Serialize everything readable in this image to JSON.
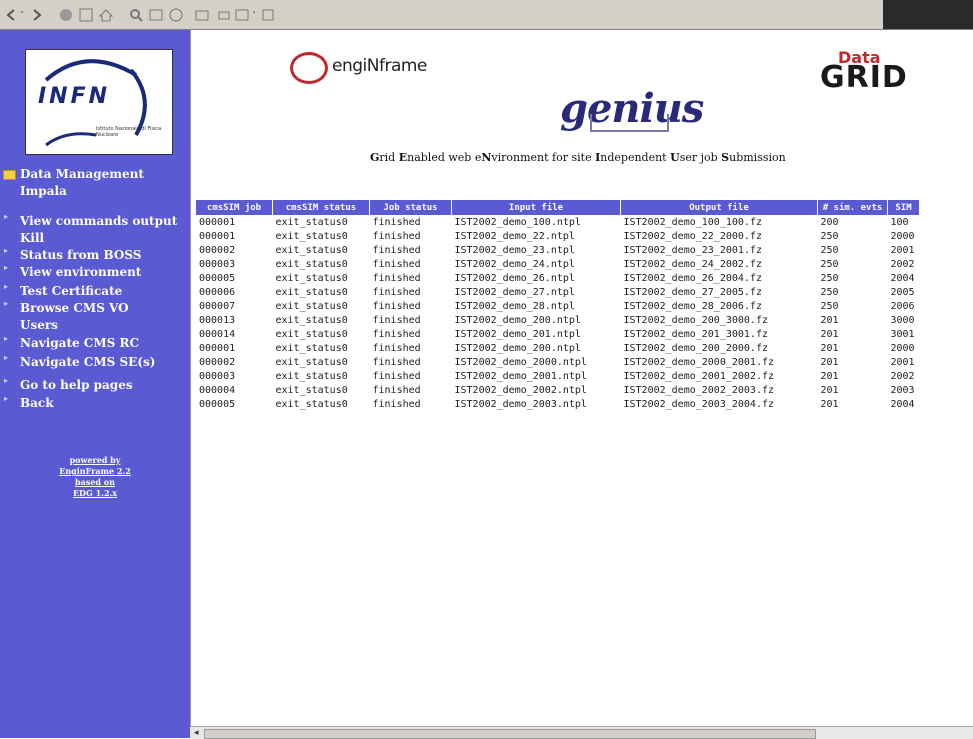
{
  "sidebar": {
    "logo": {
      "title": "INFN",
      "subtitle": "Istituto Nazionale di Fisica Nucleare"
    },
    "section": "Data Management",
    "items": [
      {
        "label": "Impala"
      },
      {
        "label": "View commands output"
      },
      {
        "label": "Kill"
      },
      {
        "label": "Status from BOSS"
      },
      {
        "label": "View environment"
      },
      {
        "label": "Test Certificate"
      },
      {
        "label": "Browse CMS VO"
      },
      {
        "label": "Users"
      },
      {
        "label": "Navigate CMS RC"
      },
      {
        "label": "Navigate CMS SE(s)"
      },
      {
        "label": "Go to help pages"
      },
      {
        "label": "Back"
      }
    ],
    "powered_by": [
      "powered by",
      "EnginFrame 2.2",
      "based on",
      "EDG 1.2.x"
    ]
  },
  "header": {
    "enginframe": "engiNframe",
    "genius": "genius",
    "datagrid_top": "Data",
    "datagrid_bottom": "GRID",
    "subtitle_parts": [
      {
        "b": "G",
        "t": "rid "
      },
      {
        "b": "E",
        "t": "nabled web e"
      },
      {
        "b": "N",
        "t": "vironment for site "
      },
      {
        "b": "I",
        "t": "ndependent "
      },
      {
        "b": "U",
        "t": "ser job "
      },
      {
        "b": "S",
        "t": "ubmission"
      }
    ]
  },
  "table": {
    "headers": [
      "cmsSIM job",
      "cmsSIM status",
      "Job status",
      "Input file",
      "Output file",
      "# sim. evts",
      "SIM"
    ],
    "rows": [
      [
        "000001",
        "exit_status0",
        "finished",
        "IST2002_demo_100.ntpl",
        "IST2002_demo_100_100.fz",
        "200",
        "100"
      ],
      [
        "000001",
        "exit_status0",
        "finished",
        "IST2002_demo_22.ntpl",
        "IST2002_demo_22_2000.fz",
        "250",
        "2000"
      ],
      [
        "000002",
        "exit_status0",
        "finished",
        "IST2002_demo_23.ntpl",
        "IST2002_demo_23_2001.fz",
        "250",
        "2001"
      ],
      [
        "000003",
        "exit_status0",
        "finished",
        "IST2002_demo_24.ntpl",
        "IST2002_demo_24_2002.fz",
        "250",
        "2002"
      ],
      [
        "000005",
        "exit_status0",
        "finished",
        "IST2002_demo_26.ntpl",
        "IST2002_demo_26_2004.fz",
        "250",
        "2004"
      ],
      [
        "000006",
        "exit_status0",
        "finished",
        "IST2002_demo_27.ntpl",
        "IST2002_demo_27_2005.fz",
        "250",
        "2005"
      ],
      [
        "000007",
        "exit_status0",
        "finished",
        "IST2002_demo_28.ntpl",
        "IST2002_demo_28_2006.fz",
        "250",
        "2006"
      ],
      [
        "000013",
        "exit_status0",
        "finished",
        "IST2002_demo_200.ntpl",
        "IST2002_demo_200_3000.fz",
        "201",
        "3000"
      ],
      [
        "000014",
        "exit_status0",
        "finished",
        "IST2002_demo_201.ntpl",
        "IST2002_demo_201_3001.fz",
        "201",
        "3001"
      ],
      [
        "000001",
        "exit_status0",
        "finished",
        "IST2002_demo_200.ntpl",
        "IST2002_demo_200_2000.fz",
        "201",
        "2000"
      ],
      [
        "000002",
        "exit_status0",
        "finished",
        "IST2002_demo_2000.ntpl",
        "IST2002_demo_2000_2001.fz",
        "201",
        "2001"
      ],
      [
        "000003",
        "exit_status0",
        "finished",
        "IST2002_demo_2001.ntpl",
        "IST2002_demo_2001_2002.fz",
        "201",
        "2002"
      ],
      [
        "000004",
        "exit_status0",
        "finished",
        "IST2002_demo_2002.ntpl",
        "IST2002_demo_2002_2003.fz",
        "201",
        "2003"
      ],
      [
        "000005",
        "exit_status0",
        "finished",
        "IST2002_demo_2003.ntpl",
        "IST2002_demo_2003_2004.fz",
        "201",
        "2004"
      ]
    ]
  },
  "colors": {
    "sidebar_bg": "#5a5ad2",
    "header_bg": "#5a5ad2",
    "brand_red": "#c0282c"
  },
  "toolbar": {
    "icons": [
      "back-icon",
      "forward-icon",
      "stop-icon",
      "refresh-icon",
      "home-icon",
      "search-icon",
      "favorites-icon",
      "history-icon",
      "mail-icon",
      "print-icon",
      "edit-icon",
      "discuss-icon"
    ]
  }
}
